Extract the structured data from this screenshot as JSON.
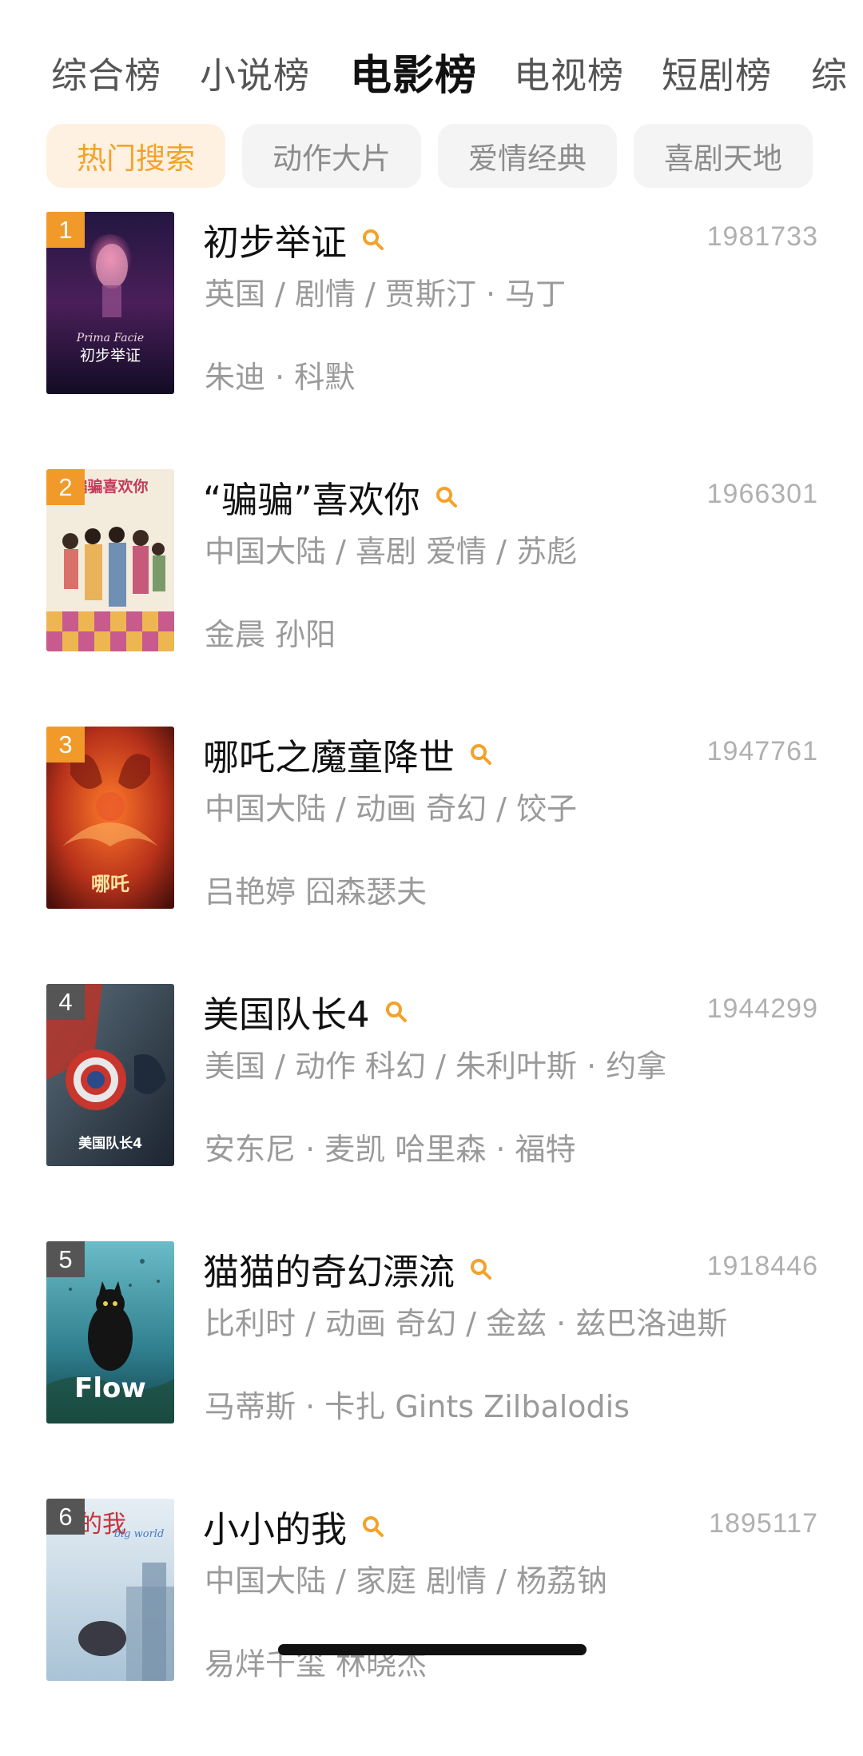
{
  "tabs": [
    "综合榜",
    "小说榜",
    "电影榜",
    "电视榜",
    "短剧榜",
    "综"
  ],
  "active_tab": "电影榜",
  "chips": [
    "热门搜索",
    "动作大片",
    "爱情经典",
    "喜剧天地"
  ],
  "active_chip": "热门搜索",
  "colors": {
    "accent": "#f3a22a",
    "rank_top": "#f19a29",
    "rank_other": "#555555"
  },
  "items": [
    {
      "rank": "1",
      "title": "初步举证",
      "score": "1981733",
      "meta": "英国 / 剧情 / 贾斯汀 · 马丁",
      "cast": "朱迪 · 科默",
      "poster_text": "初步举证",
      "poster_subtext": "Prima Facie"
    },
    {
      "rank": "2",
      "title": "“骗骗”喜欢你",
      "score": "1966301",
      "meta": "中国大陆 / 喜剧 爱情 / 苏彪",
      "cast": "金晨 孙阳",
      "poster_text": "骗骗喜欢你"
    },
    {
      "rank": "3",
      "title": "哪吒之魔童降世",
      "score": "1947761",
      "meta": "中国大陆 / 动画 奇幻 / 饺子",
      "cast": "吕艳婷 囧森瑟夫",
      "poster_text": "哪吒"
    },
    {
      "rank": "4",
      "title": "美国队长4",
      "score": "1944299",
      "meta": "美国 / 动作 科幻 / 朱利叶斯 · 约拿",
      "cast": "安东尼 · 麦凯 哈里森 · 福特",
      "poster_text": "美国队长4"
    },
    {
      "rank": "5",
      "title": "猫猫的奇幻漂流",
      "score": "1918446",
      "meta": "比利时 / 动画 奇幻 / 金兹 · 兹巴洛迪斯",
      "cast": "马蒂斯 · 卡扎 Gints Zilbalodis",
      "poster_text": "Flow"
    },
    {
      "rank": "6",
      "title": "小小的我",
      "score": "1895117",
      "meta": "中国大陆 / 家庭 剧情 / 杨荔钠",
      "cast": "易烊千玺 林晓杰",
      "poster_text": "小小的我",
      "poster_subtext": "big world"
    }
  ]
}
